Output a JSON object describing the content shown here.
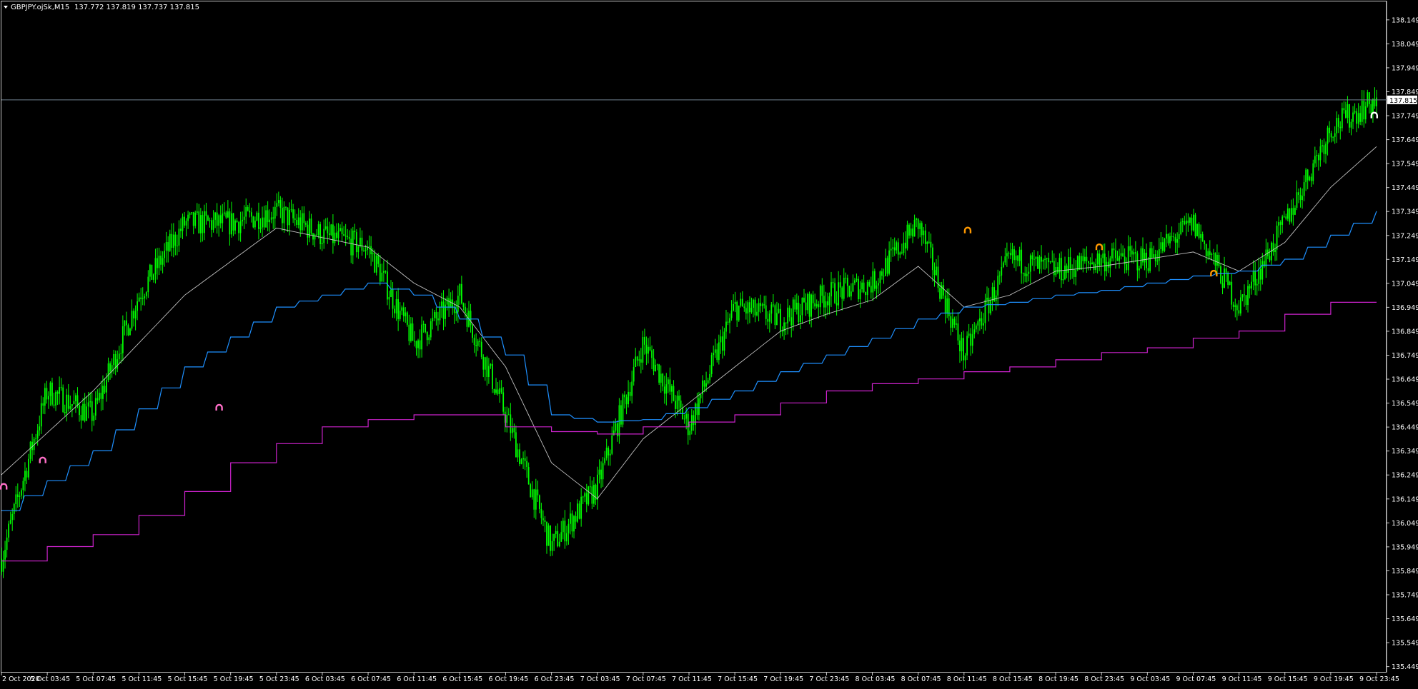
{
  "header": {
    "symbol": "GBPJPY.ojSk,M15",
    "ohlc": "137.772 137.819 137.737 137.815"
  },
  "colors": {
    "background": "#000000",
    "frame": "#c8c8c8",
    "candles": "#00ff00",
    "ma_fast": "#c0c0c0",
    "ma_slow": "#1e90ff",
    "level_line": "#cc22cc",
    "price_line": "#708090",
    "signal_pink": "#ff6ec7",
    "signal_orange": "#ff9900",
    "signal_white": "#ffffff"
  },
  "chart_data": {
    "type": "candlestick",
    "title": "GBPJPY.ojSk,M15",
    "grid": false,
    "price_axis": {
      "position": "right",
      "ticks": [
        "138.149",
        "138.049",
        "137.949",
        "137.849",
        "137.749",
        "137.649",
        "137.549",
        "137.449",
        "137.349",
        "137.249",
        "137.149",
        "137.049",
        "136.949",
        "136.849",
        "136.749",
        "136.649",
        "136.549",
        "136.449",
        "136.349",
        "136.249",
        "136.149",
        "136.049",
        "135.949",
        "135.849",
        "135.749",
        "135.649",
        "135.549",
        "135.449"
      ],
      "range": [
        135.43,
        138.22
      ],
      "current_price_label": "137.815",
      "current_price": 137.815
    },
    "time_axis": {
      "labels": [
        "2 Oct 2020",
        "5 Oct 03:45",
        "5 Oct 07:45",
        "5 Oct 11:45",
        "5 Oct 15:45",
        "5 Oct 19:45",
        "5 Oct 23:45",
        "6 Oct 03:45",
        "6 Oct 07:45",
        "6 Oct 11:45",
        "6 Oct 15:45",
        "6 Oct 19:45",
        "6 Oct 23:45",
        "7 Oct 03:45",
        "7 Oct 07:45",
        "7 Oct 11:45",
        "7 Oct 15:45",
        "7 Oct 19:45",
        "7 Oct 23:45",
        "8 Oct 03:45",
        "8 Oct 07:45",
        "8 Oct 11:45",
        "8 Oct 15:45",
        "8 Oct 19:45",
        "8 Oct 23:45",
        "9 Oct 03:45",
        "9 Oct 07:45",
        "9 Oct 11:45",
        "9 Oct 15:45",
        "9 Oct 19:45",
        "9 Oct 23:45"
      ]
    },
    "series": [
      {
        "kind": "close_path",
        "x": [
          0,
          1,
          2,
          3,
          4,
          5,
          6,
          7,
          8,
          9,
          10,
          11,
          12,
          13,
          14,
          15,
          16,
          17,
          18,
          19,
          20,
          21,
          22,
          23,
          24,
          25,
          26,
          27,
          28,
          29,
          30
        ],
        "y": [
          135.9,
          136.6,
          136.5,
          137.0,
          137.3,
          137.3,
          137.35,
          137.25,
          137.2,
          136.8,
          137.0,
          136.5,
          135.95,
          136.2,
          136.8,
          136.45,
          136.95,
          136.9,
          137.0,
          137.05,
          137.3,
          136.75,
          137.15,
          137.1,
          137.15,
          137.15,
          137.3,
          136.95,
          137.3,
          137.7,
          137.815
        ],
        "volatility": 0.11
      },
      {
        "kind": "moving_average",
        "x": [
          0,
          2,
          4,
          6,
          8,
          9,
          10,
          11,
          12,
          13,
          14,
          15,
          16,
          17,
          18,
          19,
          20,
          21,
          22,
          23,
          24,
          25,
          26,
          27,
          28,
          29,
          30
        ],
        "y": [
          136.25,
          136.6,
          137.0,
          137.28,
          137.2,
          137.05,
          136.95,
          136.7,
          136.3,
          136.15,
          136.4,
          136.55,
          136.7,
          136.85,
          136.92,
          136.98,
          137.12,
          136.95,
          137.0,
          137.1,
          137.12,
          137.15,
          137.18,
          137.1,
          137.22,
          137.45,
          137.62
        ]
      },
      {
        "kind": "moving_average",
        "x": [
          0,
          2,
          4,
          6,
          8,
          9,
          10,
          11,
          12,
          13,
          14,
          15,
          16,
          17,
          18,
          19,
          20,
          21,
          22,
          23,
          24,
          25,
          26,
          27,
          28,
          29,
          30
        ],
        "y": [
          136.1,
          136.35,
          136.7,
          136.95,
          137.05,
          137.0,
          136.9,
          136.75,
          136.5,
          136.47,
          136.48,
          136.53,
          136.6,
          136.68,
          136.75,
          136.82,
          136.9,
          136.95,
          136.97,
          137.0,
          137.02,
          137.05,
          137.08,
          137.1,
          137.15,
          137.25,
          137.35
        ]
      },
      {
        "kind": "step_level",
        "x": [
          0,
          1,
          2,
          3,
          4,
          5,
          6,
          7,
          8,
          9,
          10,
          11,
          12,
          13,
          14,
          15,
          16,
          17,
          18,
          19,
          20,
          21,
          22,
          23,
          24,
          25,
          26,
          27,
          28,
          29,
          30
        ],
        "y": [
          135.89,
          135.95,
          136.0,
          136.08,
          136.18,
          136.3,
          136.38,
          136.45,
          136.48,
          136.5,
          136.5,
          136.45,
          136.43,
          136.42,
          136.45,
          136.47,
          136.5,
          136.55,
          136.6,
          136.63,
          136.65,
          136.68,
          136.7,
          136.73,
          136.76,
          136.78,
          136.82,
          136.85,
          136.92,
          136.97,
          136.97
        ]
      }
    ],
    "signals": [
      {
        "t": 0.05,
        "price": 136.2,
        "color": "pink"
      },
      {
        "t": 0.9,
        "price": 136.31,
        "color": "pink"
      },
      {
        "t": 4.75,
        "price": 136.53,
        "color": "pink"
      },
      {
        "t": 21.08,
        "price": 137.27,
        "color": "orange"
      },
      {
        "t": 23.95,
        "price": 137.2,
        "color": "orange"
      },
      {
        "t": 26.45,
        "price": 137.09,
        "color": "orange"
      },
      {
        "t": 29.95,
        "price": 137.75,
        "color": "white"
      }
    ]
  }
}
